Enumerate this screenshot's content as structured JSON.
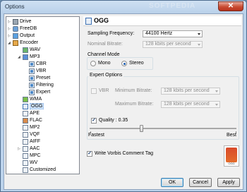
{
  "window": {
    "title": "Options",
    "close_glyph": "✕",
    "watermark": "SOFTPEDIA"
  },
  "tree": {
    "items": [
      {
        "label": "Drive",
        "icon": "drive-icon"
      },
      {
        "label": "FreeDB",
        "icon": "database-icon"
      },
      {
        "label": "Output",
        "icon": "output-icon"
      },
      {
        "label": "Encoder",
        "icon": "encoder-icon"
      },
      {
        "label": "WAV",
        "icon": "wav-icon"
      },
      {
        "label": "MP3",
        "icon": "mp3-icon"
      },
      {
        "label": "CBR",
        "icon": "document-icon"
      },
      {
        "label": "VBR",
        "icon": "document-icon"
      },
      {
        "label": "Preset",
        "icon": "document-icon"
      },
      {
        "label": "Filtering",
        "icon": "document-icon"
      },
      {
        "label": "Expert",
        "icon": "document-icon"
      },
      {
        "label": "WMA",
        "icon": "wma-icon"
      },
      {
        "label": "OGG",
        "icon": "ogg-icon"
      },
      {
        "label": "APE",
        "icon": "ape-icon"
      },
      {
        "label": "FLAC",
        "icon": "flac-icon"
      },
      {
        "label": "MP2",
        "icon": "mp2-icon"
      },
      {
        "label": "VQF",
        "icon": "vqf-icon"
      },
      {
        "label": "AIFF",
        "icon": "aiff-icon"
      },
      {
        "label": "AAC",
        "icon": "aac-icon"
      },
      {
        "label": "MPC",
        "icon": "mpc-icon"
      },
      {
        "label": "WV",
        "icon": "wv-icon"
      },
      {
        "label": "Customized",
        "icon": "customized-icon"
      }
    ],
    "selected": "OGG"
  },
  "panel": {
    "title": "OGG",
    "sampling_frequency": {
      "label": "Sampling Frequency:",
      "value": "44100 Hertz"
    },
    "nominal_bitrate": {
      "label": "Nominal Bitrate:",
      "value": "128 kbits per second"
    },
    "channel_mode": {
      "title": "Channel Mode",
      "options": [
        "Mono",
        "Stereo"
      ],
      "selected": "Stereo"
    },
    "expert": {
      "title": "Expert Options",
      "vbr_label": "VBR",
      "vbr_checked": false,
      "min_bitrate": {
        "label": "Minimum Bitrate:",
        "value": "128 kbits per second"
      },
      "max_bitrate": {
        "label": "Maximum Bitrate:",
        "value": "128 kbits per second"
      },
      "quality": {
        "label": "Quality : 0.35",
        "checked": true,
        "checkmark": "✓",
        "value": 0.35,
        "fastest": "Fastest",
        "best": "Best"
      }
    },
    "write_comment": {
      "label": "Write Vorbis Comment Tag",
      "checked": true,
      "checkmark": "✓"
    },
    "preview_caption": "OGG"
  },
  "buttons": {
    "ok": "OK",
    "cancel": "Cancel",
    "apply": "Apply"
  }
}
